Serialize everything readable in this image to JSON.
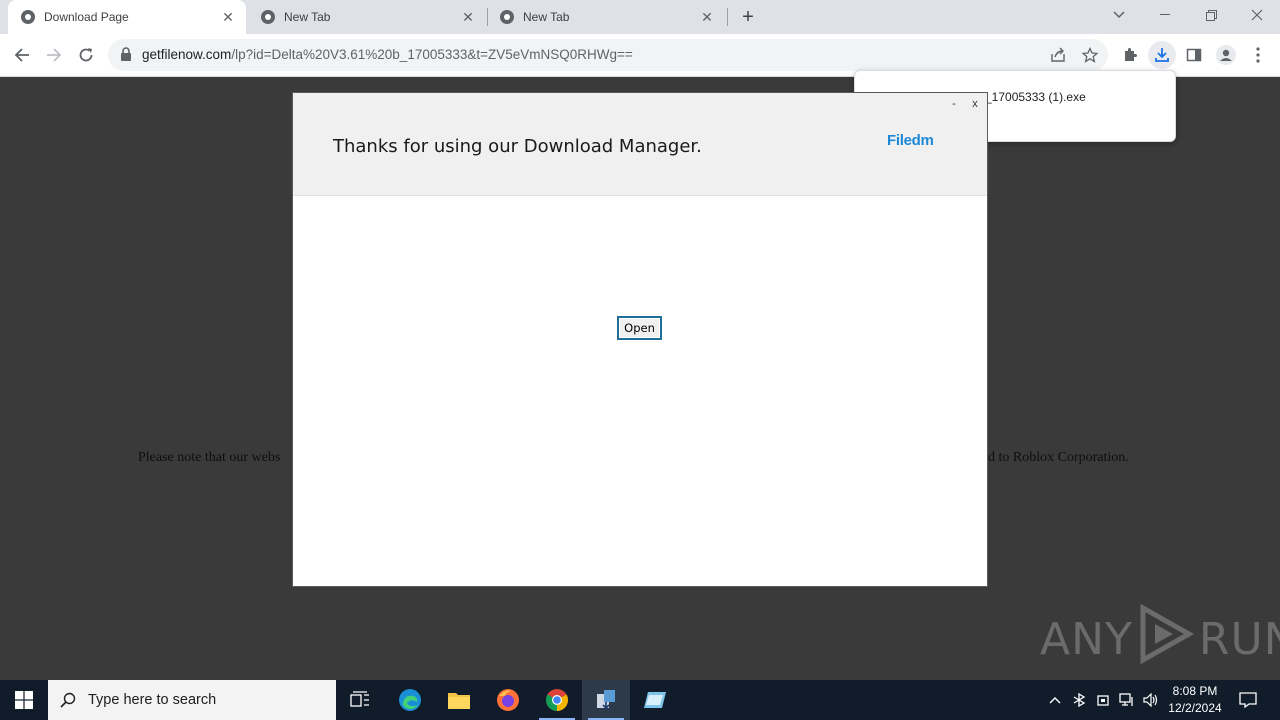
{
  "browser": {
    "tabs": [
      {
        "title": "Download Page",
        "active": true
      },
      {
        "title": "New Tab",
        "active": false
      },
      {
        "title": "New Tab",
        "active": false
      }
    ],
    "url": {
      "host": "getfilenow.com",
      "path": "/lp?id=Delta%20V3.61%20b_17005333&t=ZV5eVmNSQ0RHWg=="
    },
    "download_bubble": {
      "filename": "_17005333 (1).exe"
    }
  },
  "page": {
    "disclaimer_left": "Please note that our webs",
    "disclaimer_right": "d to Roblox Corporation."
  },
  "modal": {
    "title": "Thanks for using our Download Manager.",
    "logo": "Filedm",
    "minimize": "-",
    "close": "x",
    "open_button": "Open"
  },
  "watermark": {
    "left": "ANY",
    "right": "RUN"
  },
  "taskbar": {
    "search_placeholder": "Type here to search",
    "time": "8:08 PM",
    "date": "12/2/2024"
  },
  "colors": {
    "page_bg": "#3a3a3a",
    "modal_header_bg": "#f0f0f0",
    "logo": "#1e88d8",
    "button_border": "#1f6f9a",
    "taskbar_bg": "#101c2a"
  }
}
